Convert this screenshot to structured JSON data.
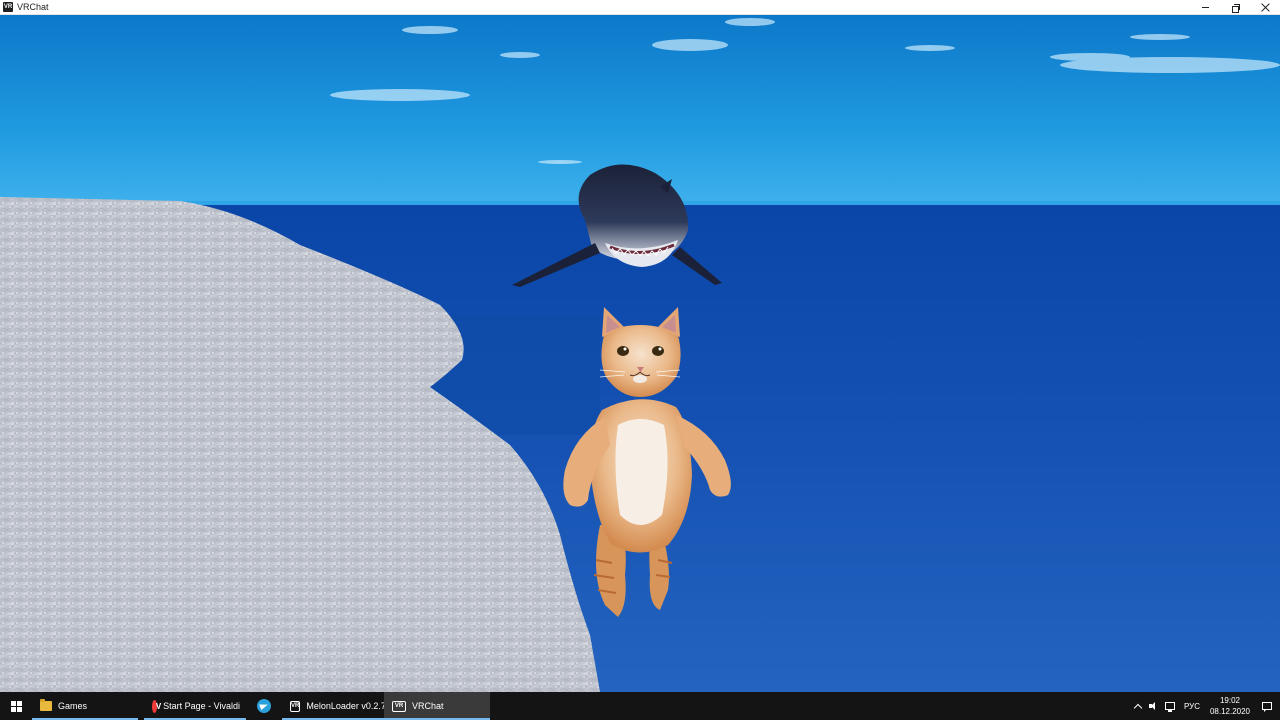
{
  "window": {
    "title": "VRChat",
    "icon": "vrchat-icon",
    "controls": [
      "minimize-icon",
      "maximize-icon",
      "close-icon"
    ]
  },
  "scene": {
    "sky_color": "#1a8fd6",
    "water_color": "#1a55b5",
    "rock_color": "#d8dde6",
    "characters": [
      "shark",
      "cat"
    ]
  },
  "taskbar": {
    "start_icon": "windows-logo-icon",
    "items": [
      {
        "icon": "folder-icon",
        "label": "Games"
      },
      {
        "icon": "vivaldi-icon",
        "label": "Start Page - Vivaldi"
      },
      {
        "icon": "telegram-icon",
        "label": ""
      },
      {
        "icon": "vr-icon",
        "label": "MelonLoader v0.2.7..."
      },
      {
        "icon": "vr-icon",
        "label": "VRChat"
      }
    ],
    "tray": {
      "icons": [
        "chevron-up-icon",
        "volume-icon",
        "network-icon"
      ],
      "language": "РУС",
      "time": "19:02",
      "date": "08.12.2020",
      "notification_icon": "action-center-icon"
    }
  },
  "icon_text": {
    "vr": "VR"
  }
}
